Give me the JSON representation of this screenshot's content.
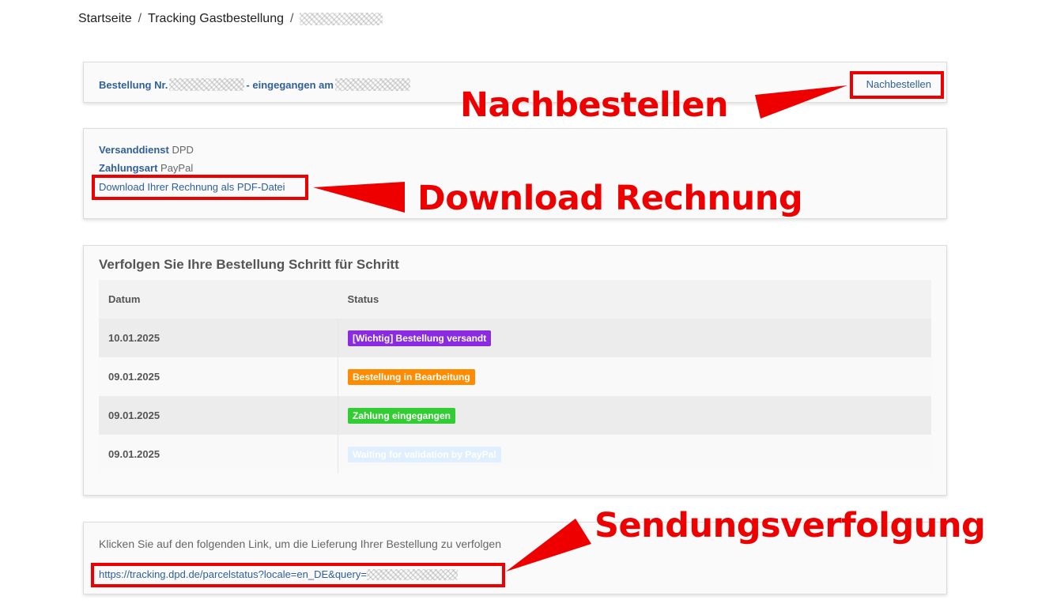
{
  "breadcrumb": {
    "home": "Startseite",
    "page": "Tracking Gastbestellung",
    "separator": "/"
  },
  "order": {
    "prefix": "Bestellung Nr.",
    "middle": "- eingegangen am",
    "reorder_label": "Nachbestellen"
  },
  "details": {
    "shipping_label": "Versanddienst",
    "shipping_value": "DPD",
    "payment_label": "Zahlungsart",
    "payment_value": "PayPal",
    "invoice_link": "Download Ihrer Rechnung als PDF-Datei"
  },
  "history": {
    "title": "Verfolgen Sie Ihre Bestellung Schritt für Schritt",
    "columns": [
      "Datum",
      "Status"
    ],
    "rows": [
      {
        "date": "10.01.2025",
        "status": "[Wichtig] Bestellung versandt",
        "color": "#8a2be2"
      },
      {
        "date": "09.01.2025",
        "status": "Bestellung in Bearbeitung",
        "color": "#ff8c00"
      },
      {
        "date": "09.01.2025",
        "status": "Zahlung eingegangen",
        "color": "#32cd32"
      },
      {
        "date": "09.01.2025",
        "status": "Waiting for validation by PayPal",
        "color": "#e0efff"
      }
    ]
  },
  "tracking": {
    "text": "Klicken Sie auf den folgenden Link, um die Lieferung Ihrer Bestellung zu verfolgen",
    "link": "https://tracking.dpd.de/parcelstatus?locale=en_DE&query="
  },
  "annotations": {
    "reorder": "Nachbestellen",
    "invoice": "Download Rechnung",
    "tracking": "Sendungsverfolgung"
  },
  "colors": {
    "link": "#2f5f9c",
    "annotation": "#ee0000"
  }
}
